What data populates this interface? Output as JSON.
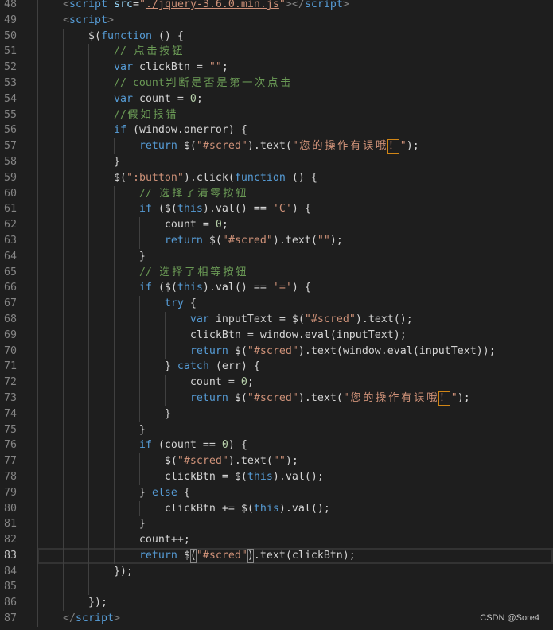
{
  "editor": {
    "colors": {
      "background": "#1e1e1e",
      "text": "#d4d4d4",
      "keyword": "#569cd6",
      "string": "#ce9178",
      "comment": "#6a9955",
      "number": "#b5cea8",
      "tag": "#569cd6",
      "tag_punctuation": "#808080",
      "attribute": "#9cdcfe",
      "line_number": "#858585",
      "line_number_active": "#c6c6c6",
      "indent_guide": "#404040",
      "line_highlight_border": "#333333",
      "bracket_match_border": "#888888",
      "unicode_highlight_border": "#d18616"
    },
    "cursor_line": 83,
    "lines": [
      {
        "no": 48,
        "code": [
          {
            "x": "    "
          },
          {
            "p": "<"
          },
          {
            "t": "script"
          },
          {
            "x": " "
          },
          {
            "a": "src"
          },
          {
            "x": "="
          },
          {
            "s": "\""
          },
          {
            "l": "./jquery-3.6.0.min.js"
          },
          {
            "s": "\""
          },
          {
            "p": "></"
          },
          {
            "t": "script"
          },
          {
            "p": ">"
          }
        ]
      },
      {
        "no": 49,
        "code": [
          {
            "x": "    "
          },
          {
            "p": "<"
          },
          {
            "t": "script"
          },
          {
            "p": ">"
          }
        ]
      },
      {
        "no": 50,
        "code": [
          {
            "x": "        $("
          },
          {
            "k": "function"
          },
          {
            "x": " () {"
          }
        ]
      },
      {
        "no": 51,
        "code": [
          {
            "x": "            "
          },
          {
            "c": "// 点击按钮"
          }
        ]
      },
      {
        "no": 52,
        "code": [
          {
            "x": "            "
          },
          {
            "k": "var"
          },
          {
            "x": " clickBtn = "
          },
          {
            "s": "\"\""
          },
          {
            "x": ";"
          }
        ]
      },
      {
        "no": 53,
        "code": [
          {
            "x": "            "
          },
          {
            "c": "// count判断是否是第一次点击"
          }
        ]
      },
      {
        "no": 54,
        "code": [
          {
            "x": "            "
          },
          {
            "k": "var"
          },
          {
            "x": " count = "
          },
          {
            "num": "0"
          },
          {
            "x": ";"
          }
        ]
      },
      {
        "no": 55,
        "code": [
          {
            "x": "            "
          },
          {
            "c": "//假如报错"
          }
        ]
      },
      {
        "no": 56,
        "code": [
          {
            "x": "            "
          },
          {
            "k": "if"
          },
          {
            "x": " (window.onerror) {"
          }
        ]
      },
      {
        "no": 57,
        "code": [
          {
            "x": "                "
          },
          {
            "k": "return"
          },
          {
            "x": " $("
          },
          {
            "s": "\"#scred\""
          },
          {
            "x": ").text("
          },
          {
            "s": "\"您的操作有误哦"
          },
          {
            "u": "！"
          },
          {
            "s": "\""
          },
          {
            "x": ");"
          }
        ]
      },
      {
        "no": 58,
        "code": [
          {
            "x": "            }"
          }
        ]
      },
      {
        "no": 59,
        "code": [
          {
            "x": "            $("
          },
          {
            "s": "\":button\""
          },
          {
            "x": ").click("
          },
          {
            "k": "function"
          },
          {
            "x": " () {"
          }
        ]
      },
      {
        "no": 60,
        "code": [
          {
            "x": "                "
          },
          {
            "c": "// 选择了清零按钮"
          }
        ]
      },
      {
        "no": 61,
        "code": [
          {
            "x": "                "
          },
          {
            "k": "if"
          },
          {
            "x": " ($("
          },
          {
            "k": "this"
          },
          {
            "x": ").val() == "
          },
          {
            "s": "'C'"
          },
          {
            "x": ") {"
          }
        ]
      },
      {
        "no": 62,
        "code": [
          {
            "x": "                    count = "
          },
          {
            "num": "0"
          },
          {
            "x": ";"
          }
        ]
      },
      {
        "no": 63,
        "code": [
          {
            "x": "                    "
          },
          {
            "k": "return"
          },
          {
            "x": " $("
          },
          {
            "s": "\"#scred\""
          },
          {
            "x": ").text("
          },
          {
            "s": "\"\""
          },
          {
            "x": ");"
          }
        ]
      },
      {
        "no": 64,
        "code": [
          {
            "x": "                }"
          }
        ]
      },
      {
        "no": 65,
        "code": [
          {
            "x": "                "
          },
          {
            "c": "// 选择了相等按钮"
          }
        ]
      },
      {
        "no": 66,
        "code": [
          {
            "x": "                "
          },
          {
            "k": "if"
          },
          {
            "x": " ($("
          },
          {
            "k": "this"
          },
          {
            "x": ").val() == "
          },
          {
            "s": "'='"
          },
          {
            "x": ") {"
          }
        ]
      },
      {
        "no": 67,
        "code": [
          {
            "x": "                    "
          },
          {
            "k": "try"
          },
          {
            "x": " {"
          }
        ]
      },
      {
        "no": 68,
        "code": [
          {
            "x": "                        "
          },
          {
            "k": "var"
          },
          {
            "x": " inputText = $("
          },
          {
            "s": "\"#scred\""
          },
          {
            "x": ").text();"
          }
        ]
      },
      {
        "no": 69,
        "code": [
          {
            "x": "                        clickBtn = window.eval(inputText);"
          }
        ]
      },
      {
        "no": 70,
        "code": [
          {
            "x": "                        "
          },
          {
            "k": "return"
          },
          {
            "x": " $("
          },
          {
            "s": "\"#scred\""
          },
          {
            "x": ").text(window.eval(inputText));"
          }
        ]
      },
      {
        "no": 71,
        "code": [
          {
            "x": "                    } "
          },
          {
            "k": "catch"
          },
          {
            "x": " (err) {"
          }
        ]
      },
      {
        "no": 72,
        "code": [
          {
            "x": "                        count = "
          },
          {
            "num": "0"
          },
          {
            "x": ";"
          }
        ]
      },
      {
        "no": 73,
        "code": [
          {
            "x": "                        "
          },
          {
            "k": "return"
          },
          {
            "x": " $("
          },
          {
            "s": "\"#scred\""
          },
          {
            "x": ").text("
          },
          {
            "s": "\"您的操作有误哦"
          },
          {
            "u": "！"
          },
          {
            "s": "\""
          },
          {
            "x": ");"
          }
        ]
      },
      {
        "no": 74,
        "code": [
          {
            "x": "                    }"
          }
        ]
      },
      {
        "no": 75,
        "code": [
          {
            "x": "                }"
          }
        ]
      },
      {
        "no": 76,
        "code": [
          {
            "x": "                "
          },
          {
            "k": "if"
          },
          {
            "x": " (count == "
          },
          {
            "num": "0"
          },
          {
            "x": ") {"
          }
        ]
      },
      {
        "no": 77,
        "code": [
          {
            "x": "                    $("
          },
          {
            "s": "\"#scred\""
          },
          {
            "x": ").text("
          },
          {
            "s": "\"\""
          },
          {
            "x": ");"
          }
        ]
      },
      {
        "no": 78,
        "code": [
          {
            "x": "                    clickBtn = $("
          },
          {
            "k": "this"
          },
          {
            "x": ").val();"
          }
        ]
      },
      {
        "no": 79,
        "code": [
          {
            "x": "                } "
          },
          {
            "k": "else"
          },
          {
            "x": " {"
          }
        ]
      },
      {
        "no": 80,
        "code": [
          {
            "x": "                    clickBtn += $("
          },
          {
            "k": "this"
          },
          {
            "x": ").val();"
          }
        ]
      },
      {
        "no": 81,
        "code": [
          {
            "x": "                }"
          }
        ]
      },
      {
        "no": 82,
        "code": [
          {
            "x": "                count++;"
          }
        ]
      },
      {
        "no": 83,
        "code": [
          {
            "x": "                "
          },
          {
            "k": "return"
          },
          {
            "x": " $"
          },
          {
            "b": "("
          },
          {
            "s": "\"#scred\""
          },
          {
            "b": ")"
          },
          {
            "x": ".text(clickBtn);"
          }
        ]
      },
      {
        "no": 84,
        "code": [
          {
            "x": "            });"
          }
        ]
      },
      {
        "no": 85,
        "code": []
      },
      {
        "no": 86,
        "code": [
          {
            "x": "        });"
          }
        ]
      },
      {
        "no": 87,
        "code": [
          {
            "x": "    "
          },
          {
            "p": "</"
          },
          {
            "t": "script"
          },
          {
            "p": ">"
          }
        ]
      }
    ]
  },
  "watermark": "CSDN @Sore4"
}
